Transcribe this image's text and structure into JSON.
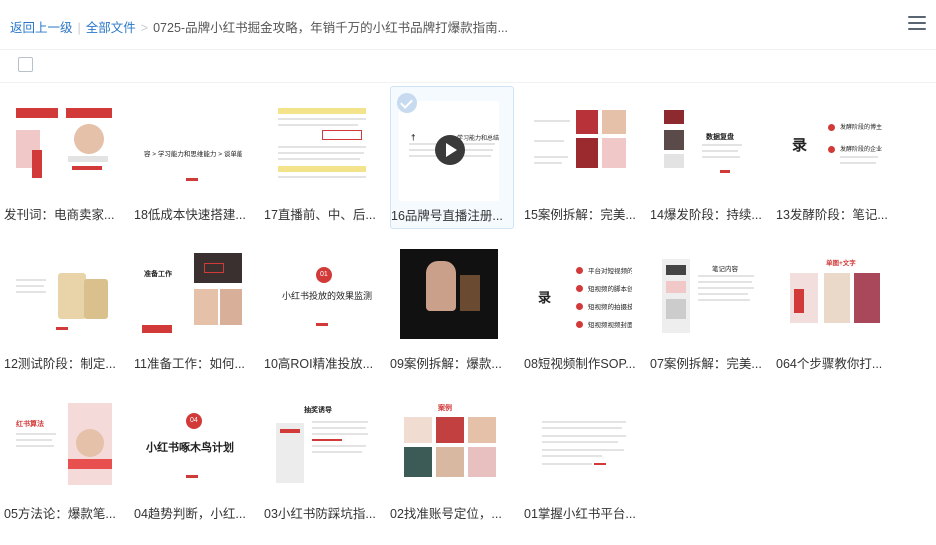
{
  "breadcrumb": {
    "back": "返回上一级",
    "all_files": "全部文件",
    "current": "0725-品牌小红书掘金攻略，年销千万的小红书品牌打爆款指南..."
  },
  "files": [
    {
      "label": "发刊词：电商卖家..."
    },
    {
      "label": "18低成本快速搭建...",
      "thumb_text": "容 > 学习能力和思维能力 > 谈单能力 > 控场能力"
    },
    {
      "label": "17直播前、中、后..."
    },
    {
      "label": "16品牌号直播注册...",
      "thumb_text": "学习能力和总结能"
    },
    {
      "label": "15案例拆解：完美..."
    },
    {
      "label": "14爆发阶段：持续...",
      "thumb_text": "数据复盘"
    },
    {
      "label": "13发酵阶段：笔记...",
      "thumb_text": "录",
      "thumb_items": [
        "发酵阶段的博主",
        "发酵阶段的企业"
      ]
    },
    {
      "label": "12测试阶段：制定..."
    },
    {
      "label": "11准备工作：如何...",
      "thumb_text": "准备工作"
    },
    {
      "label": "10高ROI精准投放...",
      "thumb_num": "01",
      "thumb_text": "小红书投放的效果监测"
    },
    {
      "label": "09案例拆解：爆款..."
    },
    {
      "label": "08短视频制作SOP...",
      "thumb_text": "录",
      "thumb_items": [
        "平台对短视频的",
        "短视频的脚本创",
        "短视频的拍摄技",
        "短视频视频封面"
      ]
    },
    {
      "label": "07案例拆解：完美...",
      "thumb_text": "笔记内容"
    },
    {
      "label": "064个步骤教你打...",
      "thumb_text": "单图+文字"
    },
    {
      "label": "05方法论：爆款笔...",
      "thumb_text": "红书算法"
    },
    {
      "label": "04趋势判断，小红...",
      "thumb_num": "04",
      "thumb_text": "小红书啄木鸟计划"
    },
    {
      "label": "03小红书防踩坑指...",
      "thumb_text": "抽奖诱导"
    },
    {
      "label": "02找准账号定位，...",
      "thumb_text": "案例"
    },
    {
      "label": "01掌握小红书平台..."
    }
  ],
  "selected_index": 3,
  "colors": {
    "accent": "#2a78c8",
    "brand_red": "#d23a3a"
  }
}
